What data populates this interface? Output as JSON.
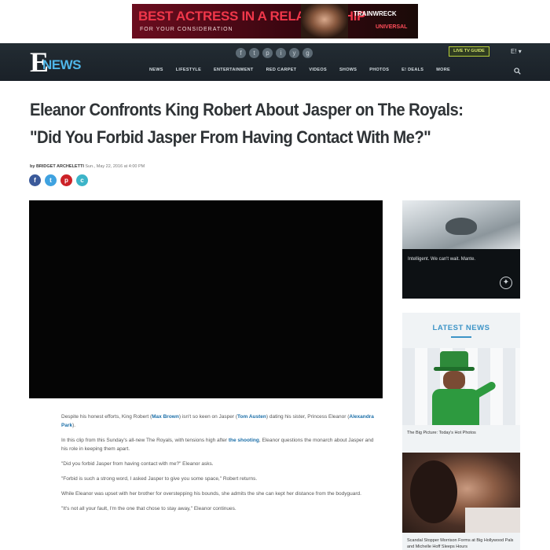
{
  "top_ad": {
    "headline": "BEST ACTRESS IN A RELATIONSHIP",
    "subline": "FOR YOUR CONSIDERATION",
    "brand": "TRAINWRECK",
    "brand_sub": "UNIVERSAL"
  },
  "nav": {
    "logo_letter": "E",
    "logo_word": "NEWS",
    "social_icons": [
      "f",
      "t",
      "p",
      "i",
      "y",
      "g"
    ],
    "links": [
      "NEWS",
      "LIFESTYLE",
      "ENTERTAINMENT",
      "RED CARPET",
      "VIDEOS",
      "SHOWS",
      "PHOTOS",
      "E! DEALS",
      "MORE"
    ],
    "cta_label": "LIVE TV GUIDE",
    "user_label": "E! ▾"
  },
  "article": {
    "title": "Eleanor Confronts King Robert About Jasper on The Royals: \"Did You Forbid Jasper From Having Contact With Me?\"",
    "byline_author": "by BRIDGET ARCHELETTI",
    "byline_date": "Sun., May 22, 2016 at 4:00 PM",
    "share_icons": [
      "f",
      "t",
      "p",
      "c"
    ],
    "paragraphs": [
      [
        {
          "t": "Despite his honest efforts, King Robert ("
        },
        {
          "t": "Max Brown",
          "hl": true
        },
        {
          "t": ") isn't so keen on Jasper ("
        },
        {
          "t": "Tom Austen",
          "hl": true
        },
        {
          "t": ") dating his sister, Princess Eleanor ("
        },
        {
          "t": "Alexandra Park",
          "hl": true
        },
        {
          "t": ")."
        }
      ],
      [
        {
          "t": "In this clip from this Sunday's all-new The Royals, with tensions high after "
        },
        {
          "t": "the shooting",
          "hl": true
        },
        {
          "t": ", Eleanor questions the monarch about Jasper and his role in keeping them apart."
        }
      ],
      [
        {
          "t": "\"Did you forbid Jasper from having contact with me?\" Eleanor asks."
        }
      ],
      [
        {
          "t": "\"Forbid is such a strong word, I asked Jasper to give you some space,\" Robert returns."
        }
      ],
      [
        {
          "t": "While Eleanor was upset with her brother for overstepping his bounds, she admits the she can kept her distance from the bodyguard."
        }
      ],
      [
        {
          "t": "\"It's not all your fault, I'm the one that chose to stay away,\" Eleanor continues."
        }
      ]
    ]
  },
  "sidebar": {
    "ad_tagline": "Intelligent. We can't wait. Mante.",
    "ad_emblem": "✦",
    "latest_header": "LATEST NEWS",
    "stories": [
      {
        "caption": "The Big Picture: Today's Hot Photos"
      },
      {
        "caption": "Scandal Stopper Morrison Forms at Big Hollywood Pals and Michelle Hoff Sleeps Hours"
      }
    ]
  }
}
